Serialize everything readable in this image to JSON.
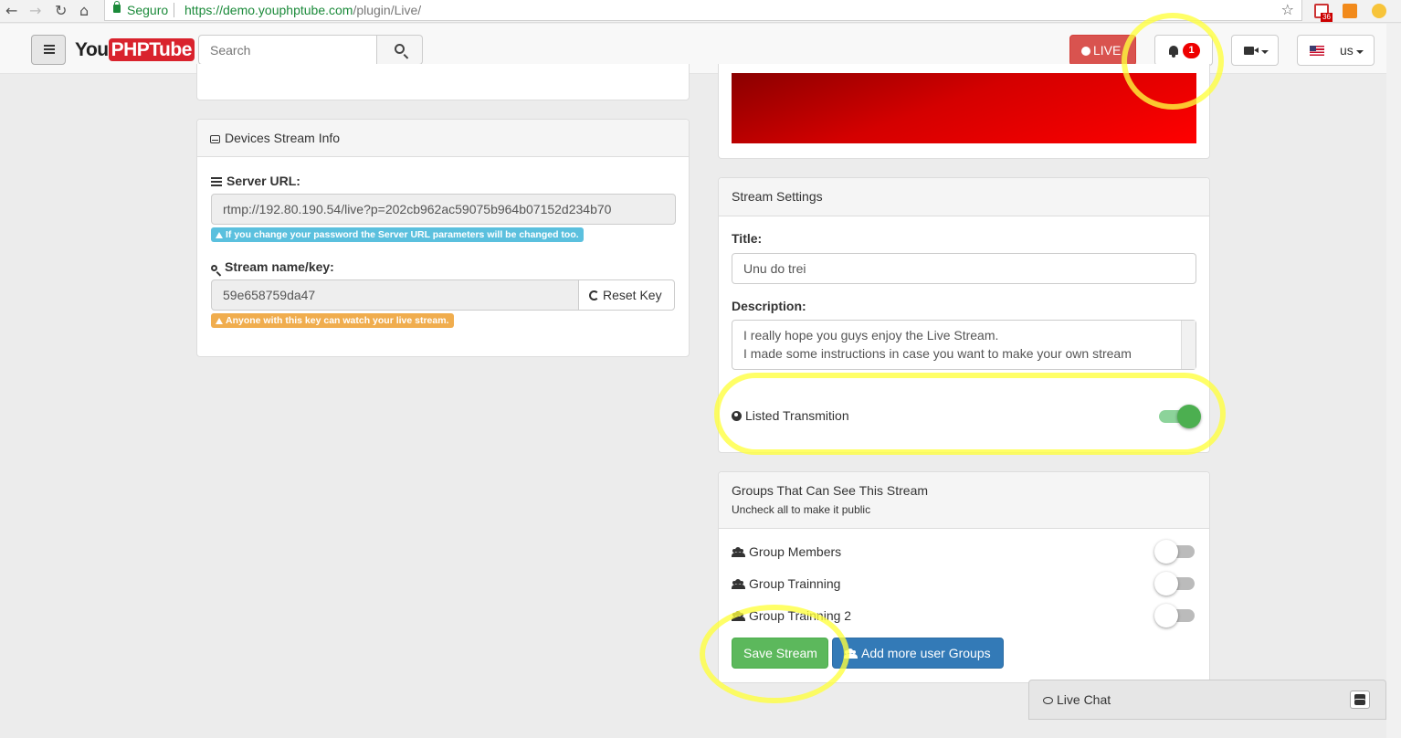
{
  "browser": {
    "secure_label": "Seguro",
    "url_host": "https://demo.youphptube.com",
    "url_path": "/plugin/Live/",
    "gmail_count": "36"
  },
  "navbar": {
    "logo_prefix": "You",
    "logo_suffix": "PHPTube",
    "search_placeholder": "Search",
    "live_label": "LIVE",
    "notification_count": "1",
    "language": "us"
  },
  "devices": {
    "title": "Devices Stream Info",
    "server_url_label": "Server URL:",
    "server_url": "rtmp://192.80.190.54/live?p=202cb962ac59075b964b07152d234b70",
    "server_url_note": "If you change your password the Server URL parameters will be changed too.",
    "stream_key_label": "Stream name/key:",
    "stream_key": "59e658759da47",
    "reset_key_label": "Reset Key",
    "stream_key_note": "Anyone with this key can watch your live stream."
  },
  "stream_settings": {
    "header": "Stream Settings",
    "title_label": "Title:",
    "title_value": "Unu do trei",
    "description_label": "Description:",
    "description_value": "I really hope you guys enjoy the Live Stream.\nI made some instructions in case you want to make your own stream",
    "listed_label": "Listed Transmition",
    "listed_on": true
  },
  "groups": {
    "header": "Groups That Can See This Stream",
    "subtitle": "Uncheck all to make it public",
    "items": [
      {
        "label": "Group Members",
        "checked": false
      },
      {
        "label": "Group Trainning",
        "checked": false
      },
      {
        "label": "Group Trainning 2",
        "checked": false
      }
    ],
    "save_label": "Save Stream",
    "add_groups_label": "Add more user Groups"
  },
  "chat": {
    "label": "Live Chat"
  },
  "colors": {
    "live_red": "#d9534f",
    "preview_red": "#d40000",
    "save_green": "#5cb85c",
    "add_blue": "#337ab7",
    "annotation_yellow": "#ffff3c"
  }
}
